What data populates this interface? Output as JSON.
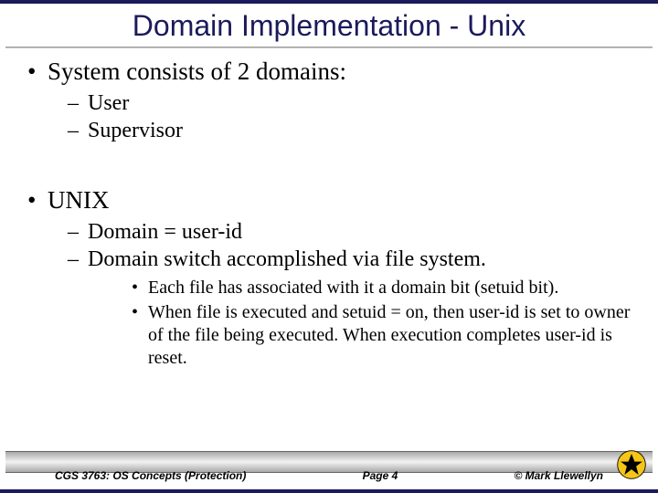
{
  "title": "Domain Implementation - Unix",
  "b1": {
    "text": "System consists of 2 domains:",
    "sub": [
      "User",
      "Supervisor"
    ]
  },
  "b2": {
    "text": "UNIX",
    "sub1": "Domain = user-id",
    "sub2": "Domain switch accomplished via file system.",
    "subsub": [
      "Each file has associated with it a domain bit (setuid bit).",
      "When file is executed and setuid = on, then user-id is set to owner of the file being executed. When execution completes user-id is reset."
    ]
  },
  "footer": {
    "course": "CGS 3763: OS Concepts (Protection)",
    "page": "Page 4",
    "copyright": "© Mark Llewellyn"
  }
}
